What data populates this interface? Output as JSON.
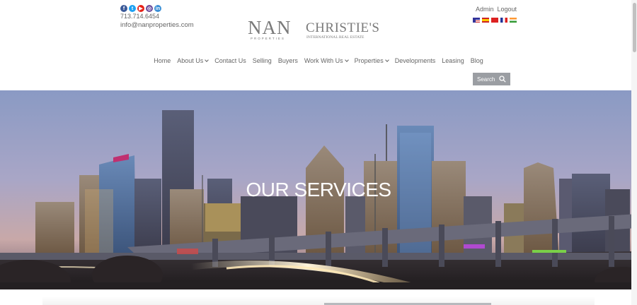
{
  "header": {
    "phone": "713.714.6454",
    "email": "info@nanproperties.com",
    "social_icons": [
      "facebook-icon",
      "twitter-icon",
      "youtube-icon",
      "instagram-icon",
      "linkedin-icon"
    ],
    "admin_label": "Admin",
    "logout_label": "Logout",
    "flags": [
      "us-flag",
      "spain-flag",
      "china-flag",
      "france-flag",
      "india-flag"
    ]
  },
  "logo": {
    "nan_text": "NAN",
    "nan_sub": "PROPERTIES",
    "christies_text": "CHRISTIE'S",
    "christies_sub": "INTERNATIONAL REAL ESTATE"
  },
  "nav": {
    "items": [
      {
        "label": "Home",
        "dropdown": false
      },
      {
        "label": "About Us",
        "dropdown": true
      },
      {
        "label": "Contact Us",
        "dropdown": false
      },
      {
        "label": "Selling",
        "dropdown": false
      },
      {
        "label": "Buyers",
        "dropdown": false
      },
      {
        "label": "Work With Us",
        "dropdown": true
      },
      {
        "label": "Properties",
        "dropdown": true
      },
      {
        "label": "Developments",
        "dropdown": false
      },
      {
        "label": "Leasing",
        "dropdown": false
      },
      {
        "label": "Blog",
        "dropdown": false
      }
    ],
    "search_label": "Search"
  },
  "hero": {
    "title": "OUR SERVICES"
  },
  "colors": {
    "text": "#666666",
    "search_bg": "#9b9ea3",
    "logo_gray": "#7a7a7a",
    "logo_accent": "#b08a6a"
  }
}
